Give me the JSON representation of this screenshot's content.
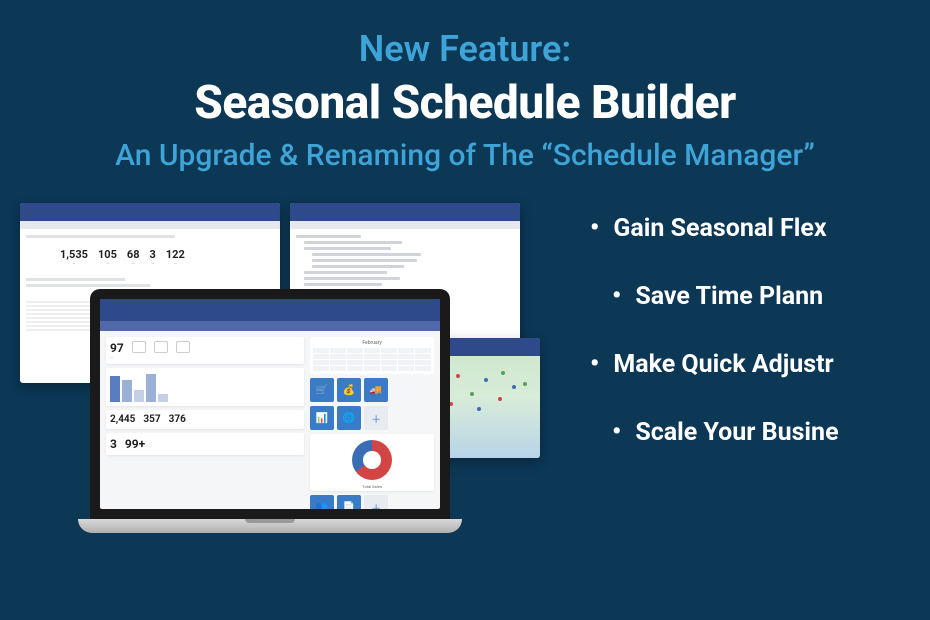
{
  "header": {
    "kicker": "New Feature:",
    "title": "Seasonal Schedule Builder",
    "subtitle": "An Upgrade & Renaming of The “Schedule Manager”"
  },
  "bullets": [
    "Gain Seasonal Flex",
    "Save Time Plann",
    "Make Quick Adjustr",
    "Scale Your Busine"
  ],
  "mockup": {
    "back_left_stats": [
      {
        "num": "1,535",
        "label": ""
      },
      {
        "num": "105",
        "label": ""
      },
      {
        "num": "68",
        "label": ""
      },
      {
        "num": "3",
        "label": ""
      },
      {
        "num": "122",
        "label": ""
      }
    ],
    "laptop": {
      "top_stat": "97",
      "mid_stats": [
        {
          "num": "2,445",
          "label": ""
        },
        {
          "num": "357",
          "label": ""
        },
        {
          "num": "376",
          "label": ""
        }
      ],
      "bottom_stats": [
        {
          "num": "3",
          "label": ""
        },
        {
          "num": "99+",
          "label": ""
        }
      ],
      "cal_label": "February"
    }
  },
  "colors": {
    "bg": "#0c3755",
    "accent": "#3ea3d6",
    "panel_header": "#2e4a8a"
  }
}
